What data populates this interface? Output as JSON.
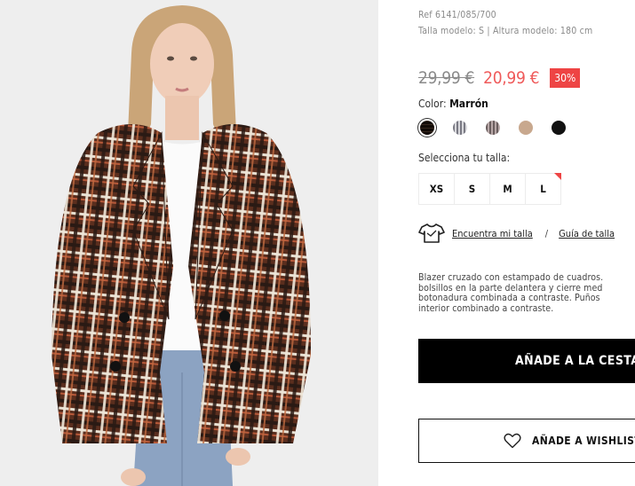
{
  "product": {
    "ref": "Ref 6141/085/700",
    "model_info": "Talla modelo: S | Altura modelo: 180 cm",
    "old_price": "29,99 €",
    "new_price": "20,99 €",
    "discount": "30%",
    "color_label": "Color:",
    "color_value": "Marrón",
    "swatches": [
      {
        "name": "plaid-brown",
        "color": "#4a3a30",
        "selected": true
      },
      {
        "name": "plaid-grey",
        "color": "#9a9aa2",
        "selected": false
      },
      {
        "name": "plaid-dark-grey",
        "color": "#7a7070",
        "selected": false
      },
      {
        "name": "tan",
        "color": "#c8a88e",
        "selected": false
      },
      {
        "name": "black",
        "color": "#111111",
        "selected": false
      }
    ],
    "size_label": "Selecciona tu talla:",
    "sizes": [
      "XS",
      "S",
      "M",
      "L"
    ],
    "find_size": "Encuentra mi talla",
    "separator": "/",
    "size_guide": "Guía de talla",
    "description": "Blazer cruzado con estampado de cuadros.\nbolsillos en la parte delantera y cierre med\nbotonadura combinada a contraste. Puños\ninterior combinado a contraste.",
    "add_to_cart": "AÑADE A LA CESTA",
    "add_to_wishlist": "AÑADE A WISHLIST"
  }
}
